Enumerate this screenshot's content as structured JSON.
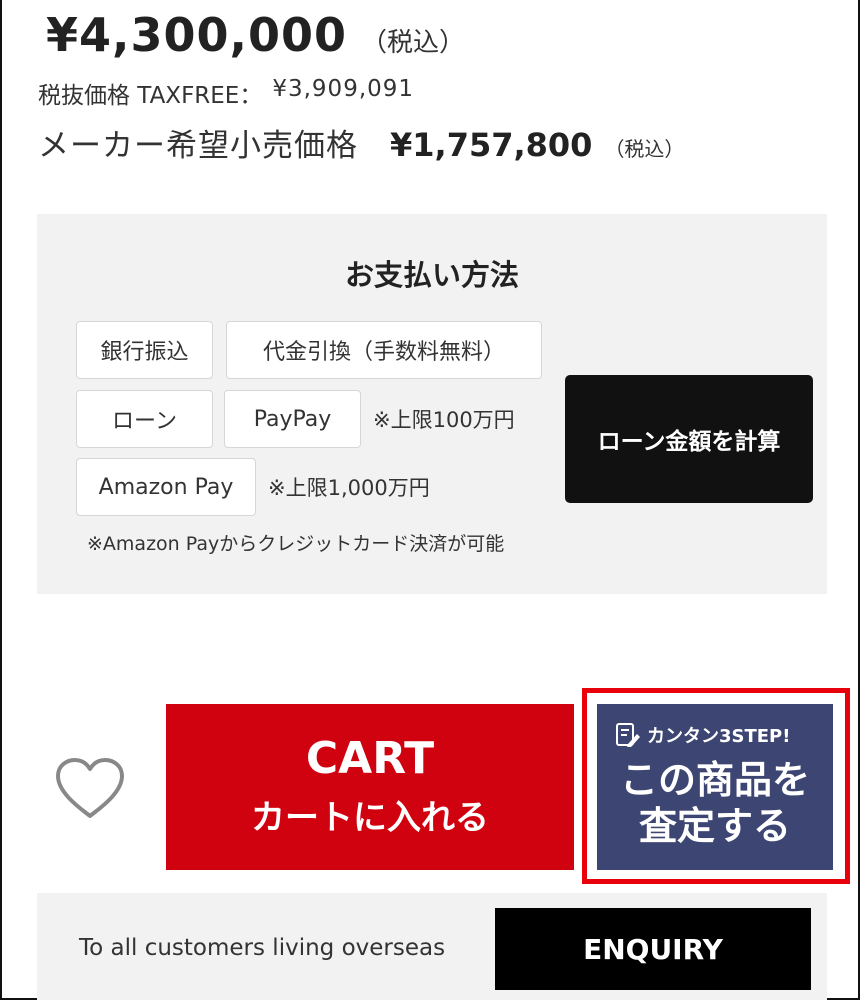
{
  "price": {
    "amount": "¥4,300,000",
    "tax_note": "（税込）",
    "taxfree_label": "税抜価格 TAXFREE：",
    "taxfree_value": "¥3,909,091",
    "msrp_label": "メーカー希望小売価格",
    "msrp_amount": "¥1,757,800",
    "msrp_tax_note": "（税込）"
  },
  "payment": {
    "title": "お支払い方法",
    "methods": [
      "銀行振込",
      "代金引換（手数料無料）",
      "ローン",
      "PayPay",
      "Amazon Pay"
    ],
    "paypay_note": "※上限100万円",
    "amazon_note": "※上限1,000万円",
    "amazon_credit_note": "※Amazon Payからクレジットカード決済が可能",
    "loan_calc_label": "ローン金額を計算"
  },
  "actions": {
    "cart_en": "CART",
    "cart_ja": "カートに入れる",
    "assess_top": "カンタン3STEP!",
    "assess_line1": "この商品を",
    "assess_line2": "査定する",
    "favorite_icon": "heart-icon",
    "assess_icon": "form-pencil-icon",
    "highlight_color": "#e8000a",
    "cart_color": "#d0020f",
    "assess_color": "#3d4673"
  },
  "overseas": {
    "text": "To all customers living overseas",
    "button": "ENQUIRY"
  }
}
